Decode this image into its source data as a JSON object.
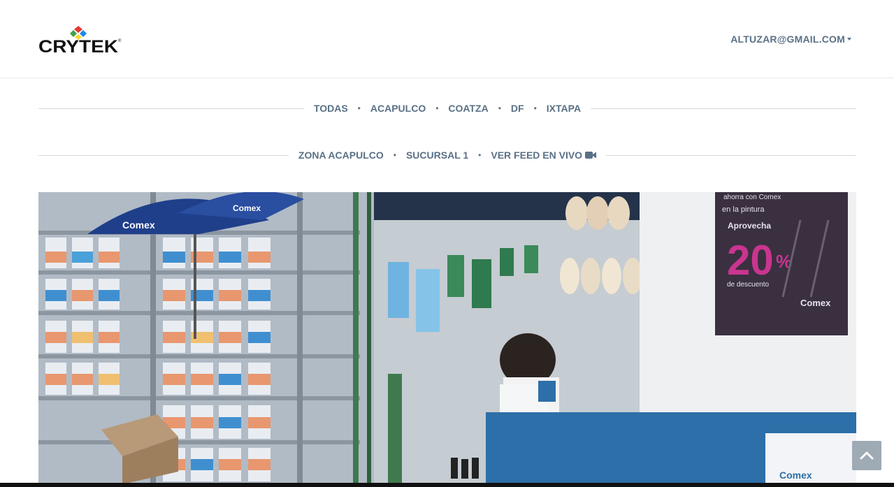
{
  "header": {
    "logo_text": "CRYTEK",
    "user_email": "ALTUZAR@GMAIL.COM"
  },
  "regions": {
    "items": [
      {
        "label": "TODAS"
      },
      {
        "label": "ACAPULCO"
      },
      {
        "label": "COATZA"
      },
      {
        "label": "DF"
      },
      {
        "label": "IXTAPA"
      }
    ]
  },
  "breadcrumb": {
    "zone": "ZONA ACAPULCO",
    "branch": "SUCURSAL 1",
    "live_feed": "VER FEED EN VIVO",
    "live_icon": "video-camera-icon"
  },
  "feed": {
    "poster_top": "ahorra con Comex",
    "poster_line": "en la pintura",
    "poster_sub": "Aprovecha",
    "poster_number": "20",
    "poster_pct": "%",
    "poster_bottom": "de descuento",
    "poster_brand": "Comex",
    "umbrella_brand": "Comex",
    "umbrella_brand_2": "Comex",
    "counter_sign": "Comex"
  },
  "colors": {
    "nav_text": "#5a7086",
    "divider": "#d5d9dd",
    "scroll_button": "#9eaab4"
  },
  "scroll_button": {
    "icon": "chevron-up-icon"
  }
}
